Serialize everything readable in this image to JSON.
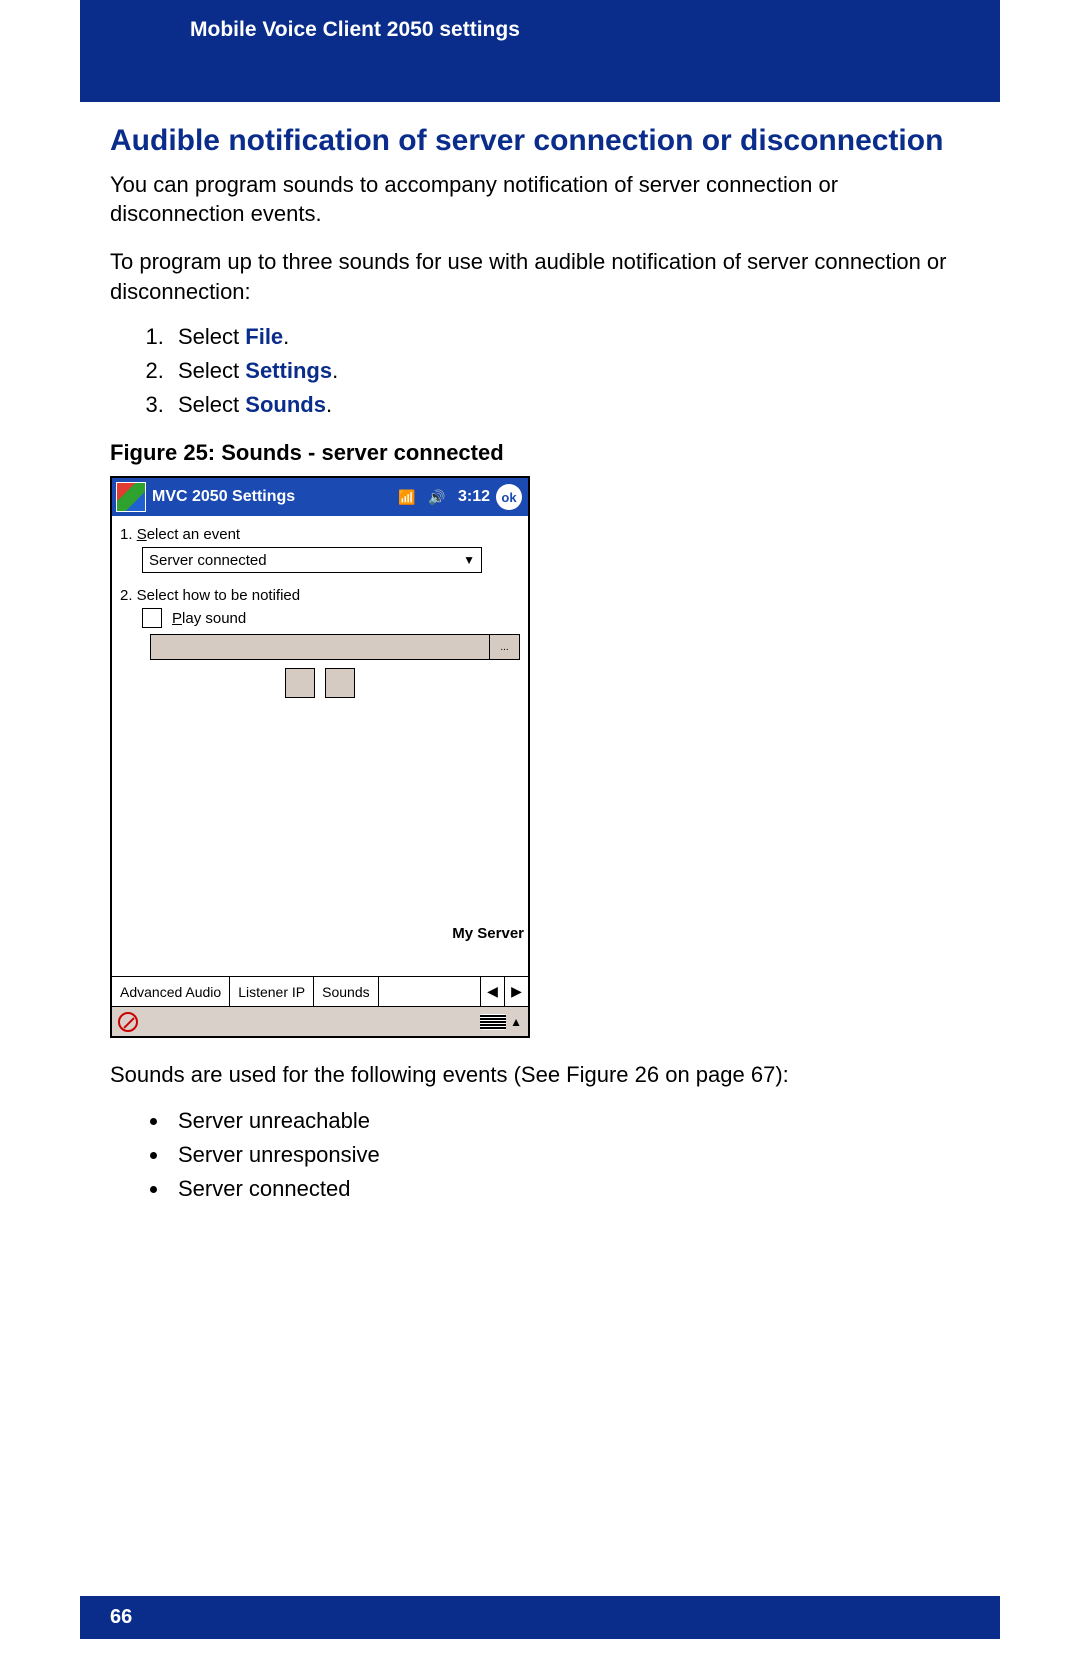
{
  "header": {
    "title": "Mobile Voice Client 2050 settings"
  },
  "section": {
    "title": "Audible notification of server connection or disconnection",
    "para1": "You can program sounds to accompany notification of server connection or disconnection events.",
    "para2": "To program up to three sounds for use with audible notification of server connection or disconnection:",
    "steps": [
      {
        "prefix": "Select ",
        "link": "File",
        "suffix": "."
      },
      {
        "prefix": "Select ",
        "link": "Settings",
        "suffix": "."
      },
      {
        "prefix": "Select ",
        "link": "Sounds",
        "suffix": "."
      }
    ],
    "figure_caption": "Figure 25: Sounds - server connected",
    "after_figure": "Sounds are used for the following events (See Figure 26 on page 67):",
    "events": [
      "Server unreachable",
      "Server unresponsive",
      "Server connected"
    ]
  },
  "pda": {
    "title": "MVC 2050 Settings",
    "time": "3:12",
    "ok": "ok",
    "step1_num": "1.",
    "step1_label_pre": "",
    "step1_label_u": "S",
    "step1_label_rest": "elect an event",
    "combo_value": "Server connected",
    "step2": "2. Select how to be notified",
    "play_u": "P",
    "play_rest": "lay sound",
    "browse": "...",
    "my_server": "My Server",
    "tabs": [
      "Advanced Audio",
      "Listener IP",
      "Sounds"
    ]
  },
  "footer": {
    "page": "66"
  }
}
